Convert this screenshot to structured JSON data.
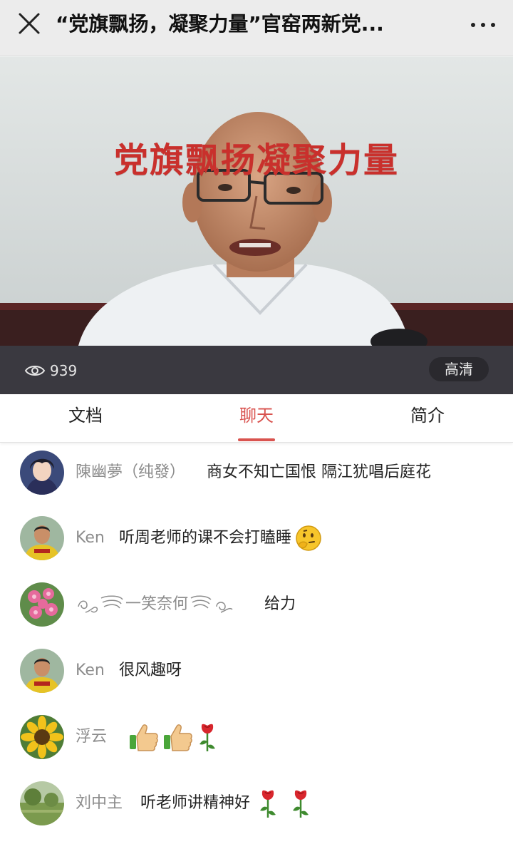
{
  "header": {
    "title": "“党旗飘扬，凝聚力量”官窑两新党..."
  },
  "video": {
    "banner_text": "党旗飘扬凝聚力量",
    "view_count": "939",
    "quality_label": "高清"
  },
  "tabs": [
    {
      "label": "文档",
      "active": false
    },
    {
      "label": "聊天",
      "active": true
    },
    {
      "label": "简介",
      "active": false
    }
  ],
  "colors": {
    "accent": "#d9534f",
    "video_bar": "#3a3940",
    "topbar": "#ececec"
  },
  "chat": {
    "messages": [
      {
        "user": "陳幽夢（纯發）",
        "text": "商女不知亡国恨 隔江犹唱后庭花",
        "emoji": []
      },
      {
        "user": "Ken",
        "text": "听周老师的课不会打瞌睡",
        "emoji": [
          "thinking-face-icon"
        ]
      },
      {
        "user": "一笑奈何",
        "text": "给力",
        "emoji": []
      },
      {
        "user": "Ken",
        "text": "很风趣呀",
        "emoji": []
      },
      {
        "user": "浮云",
        "text": "",
        "emoji": [
          "thumbs-up-icon",
          "thumbs-up-icon",
          "rose-icon"
        ]
      },
      {
        "user": "刘中主",
        "text": "听老师讲精神好",
        "emoji": [
          "rose-icon",
          "rose-icon"
        ]
      }
    ]
  }
}
